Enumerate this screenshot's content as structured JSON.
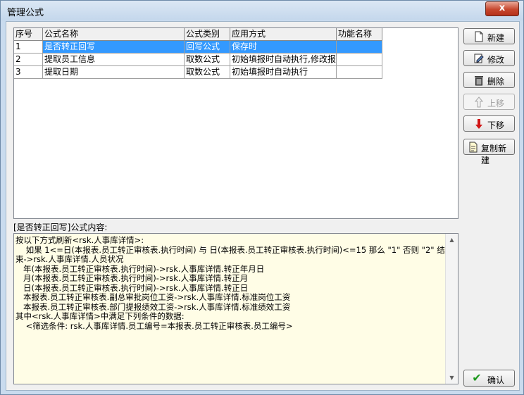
{
  "window": {
    "title": "管理公式",
    "close_label": "x"
  },
  "grid": {
    "columns": [
      "序号",
      "公式名称",
      "公式类别",
      "应用方式",
      "功能名称"
    ],
    "rows": [
      [
        "1",
        "是否转正回写",
        "回写公式",
        "保存时",
        ""
      ],
      [
        "2",
        "提取员工信息",
        "取数公式",
        "初始填报时自动执行,修改报",
        ""
      ],
      [
        "3",
        "提取日期",
        "取数公式",
        "初始填报时自动执行",
        ""
      ]
    ],
    "selected_row": 1
  },
  "formula_label": "[是否转正回写]公式内容:",
  "formula_content": "按以下方式刷新<rsk.人事库详情>:\n    如果 1<=日(本报表.员工转正审核表.执行时间) 与 日(本报表.员工转正审核表.执行时间)<=15 那么 \"1\" 否则 \"2\" 结束->rsk.人事库详情.人员状况\n   年(本报表.员工转正审核表.执行时间)->rsk.人事库详情.转正年月日\n   月(本报表.员工转正审核表.执行时间)->rsk.人事库详情.转正月\n   日(本报表.员工转正审核表.执行时间)->rsk.人事库详情.转正日\n   本报表.员工转正审核表.副总审批岗位工资->rsk.人事库详情.标准岗位工资\n   本报表.员工转正审核表.部门提报绩效工资->rsk.人事库详情.标准绩效工资\n其中<rsk.人事库详情>中满足下列条件的数据:\n    <筛选条件: rsk.人事库详情.员工编号=本报表.员工转正审核表.员工编号>",
  "buttons": {
    "new": "新建",
    "edit": "修改",
    "delete": "删除",
    "up": "上移",
    "down": "下移",
    "copy_new": "复制新建",
    "ok": "确认"
  },
  "icons": {
    "new": "new-document-icon",
    "edit": "edit-icon",
    "delete": "trash-icon",
    "up": "arrow-up-icon",
    "down": "arrow-down-icon",
    "copy_new": "copy-icon",
    "ok": "checkmark-icon"
  },
  "colors": {
    "selection": "#3399ff",
    "content_bg": "#fffde6",
    "down_arrow": "#d11414",
    "ok_check": "#1e9a1e"
  }
}
